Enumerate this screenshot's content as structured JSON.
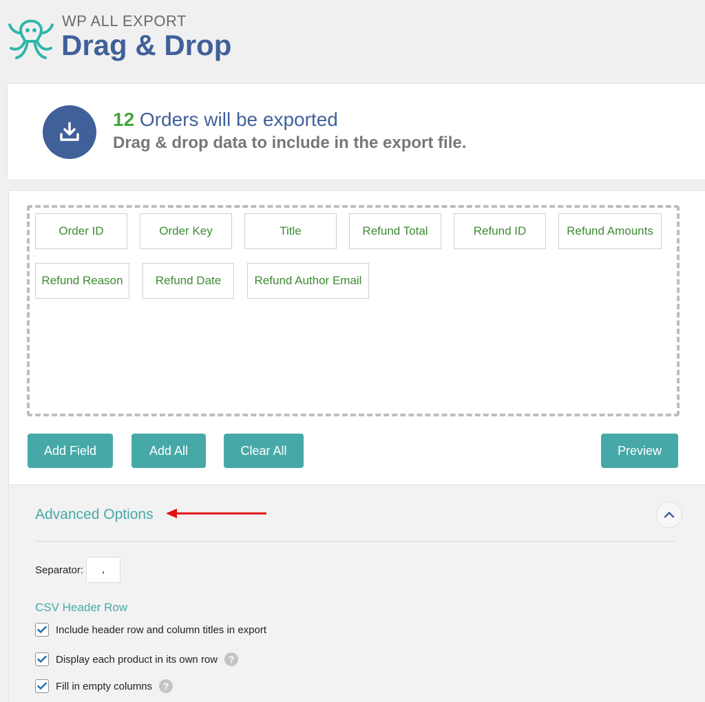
{
  "header": {
    "brand_small": "WP ALL EXPORT",
    "brand_big": "Drag & Drop",
    "logo_icon": "octopus-logo-icon",
    "logo_color": "#2fb5aa"
  },
  "summary": {
    "count": "12",
    "line1_rest": " Orders will be exported",
    "line2": "Drag & drop data to include in the export file.",
    "icon": "download-icon"
  },
  "fields": [
    "Order ID",
    "Order Key",
    "Title",
    "Refund Total",
    "Refund ID",
    "Refund Amounts",
    "Refund Reason",
    "Refund Date",
    "Refund Author Email"
  ],
  "buttons": {
    "add_field": "Add Field",
    "add_all": "Add All",
    "clear_all": "Clear All",
    "preview": "Preview"
  },
  "advanced": {
    "title": "Advanced Options",
    "separator_label": "Separator:",
    "separator_value": ",",
    "csv_header_title": "CSV Header Row",
    "options": [
      {
        "label": "Include header row and column titles in export",
        "checked": true,
        "help": false
      },
      {
        "label": "Display each product in its own row",
        "checked": true,
        "help": true
      },
      {
        "label": "Fill in empty columns",
        "checked": true,
        "help": true
      }
    ],
    "help_glyph": "?"
  },
  "colors": {
    "brand_blue": "#40609a",
    "accent_teal": "#46a9a8",
    "count_green": "#46a53c",
    "field_green": "#3d8b32",
    "annotation_red": "#e01010"
  }
}
